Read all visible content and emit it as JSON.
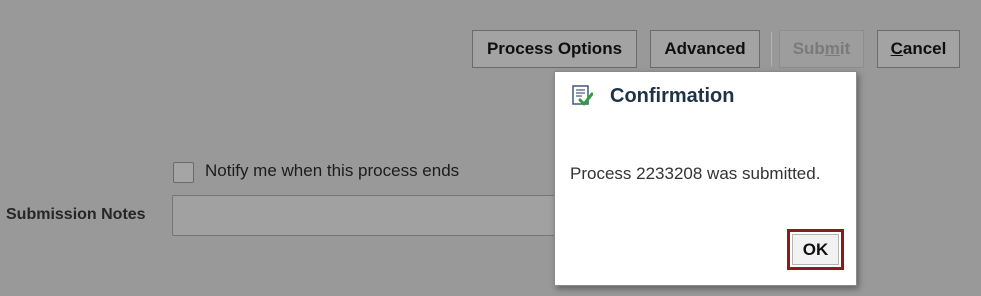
{
  "toolbar": {
    "process_options": "Process Options",
    "advanced": "Advanced",
    "submit": {
      "pre": "Sub",
      "accel": "m",
      "post": "it"
    },
    "cancel": {
      "accel": "C",
      "post": "ancel"
    }
  },
  "form": {
    "notify_label": "Notify me when this process ends",
    "notify_checked": false,
    "submission_notes_label": "Submission Notes",
    "submission_notes_value": ""
  },
  "dialog": {
    "title": "Confirmation",
    "icon": "document-check-icon",
    "message": "Process 2233208 was submitted.",
    "ok_label": "OK"
  },
  "colors": {
    "overlay_background": "#999999",
    "highlight_border": "#8b1a1a",
    "dialog_title": "#1f3347"
  }
}
